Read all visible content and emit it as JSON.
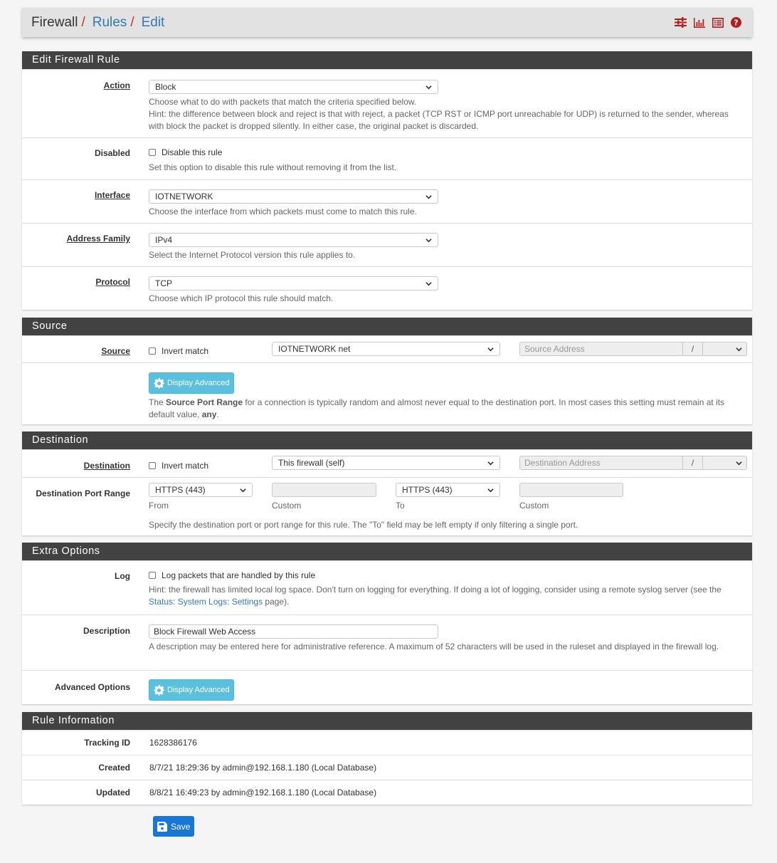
{
  "breadcrumb": {
    "root": "Firewall",
    "items": [
      "Rules",
      "Edit"
    ],
    "separator": "/"
  },
  "header_icons": [
    "sliders-icon",
    "bar-chart-icon",
    "list-icon",
    "help-icon"
  ],
  "colors": {
    "accent_red": "#c9302c",
    "link_blue": "#337ab7",
    "panel_heading_bg": "#424242",
    "info_button": "#5bc0de",
    "primary_button": "#1976d2"
  },
  "edit_rule": {
    "title": "Edit Firewall Rule",
    "action": {
      "label": "Action",
      "value": "Block",
      "help_line1": "Choose what to do with packets that match the criteria specified below.",
      "help_line2": "Hint: the difference between block and reject is that with reject, a packet (TCP RST or ICMP port unreachable for UDP) is returned to the sender, whereas with block the packet is dropped silently. In either case, the original packet is discarded."
    },
    "disabled": {
      "label": "Disabled",
      "checkbox_label": "Disable this rule",
      "checked": false,
      "help": "Set this option to disable this rule without removing it from the list."
    },
    "interface": {
      "label": "Interface",
      "value": "IOTNETWORK",
      "help": "Choose the interface from which packets must come to match this rule."
    },
    "address_family": {
      "label": "Address Family",
      "value": "IPv4",
      "help": "Select the Internet Protocol version this rule applies to."
    },
    "protocol": {
      "label": "Protocol",
      "value": "TCP",
      "help": "Choose which IP protocol this rule should match."
    }
  },
  "source": {
    "title": "Source",
    "label": "Source",
    "invert_label": "Invert match",
    "invert_checked": false,
    "type_value": "IOTNETWORK net",
    "address_placeholder": "Source Address",
    "slash": "/",
    "mask_value": "",
    "advanced_button": "Display Advanced",
    "help_pre": "The ",
    "help_bold": "Source Port Range",
    "help_mid": " for a connection is typically random and almost never equal to the destination port. In most cases this setting must remain at its default value, ",
    "help_bold2": "any",
    "help_post": "."
  },
  "destination": {
    "title": "Destination",
    "label": "Destination",
    "invert_label": "Invert match",
    "invert_checked": false,
    "type_value": "This firewall (self)",
    "address_placeholder": "Destination Address",
    "slash": "/",
    "mask_value": "",
    "port_range_label": "Destination Port Range",
    "from_value": "HTTPS (443)",
    "from_label": "From",
    "from_custom_label": "Custom",
    "to_value": "HTTPS (443)",
    "to_label": "To",
    "to_custom_label": "Custom",
    "help": "Specify the destination port or port range for this rule. The \"To\" field may be left empty if only filtering a single port."
  },
  "extra_options": {
    "title": "Extra Options",
    "log": {
      "label": "Log",
      "checkbox_label": "Log packets that are handled by this rule",
      "checked": false,
      "help_pre": "Hint: the firewall has limited local log space. Don't turn on logging for everything. If doing a lot of logging, consider using a remote syslog server (see the ",
      "help_link": "Status: System Logs: Settings",
      "help_post": " page)."
    },
    "description": {
      "label": "Description",
      "value": "Block Firewall Web Access",
      "help": "A description may be entered here for administrative reference. A maximum of 52 characters will be used in the ruleset and displayed in the firewall log."
    },
    "advanced": {
      "label": "Advanced Options",
      "button": "Display Advanced"
    }
  },
  "rule_info": {
    "title": "Rule Information",
    "rows": [
      {
        "label": "Tracking ID",
        "value": "1628386176"
      },
      {
        "label": "Created",
        "value": "8/7/21 18:29:36 by admin@192.168.1.180 (Local Database)"
      },
      {
        "label": "Updated",
        "value": "8/8/21 16:49:23 by admin@192.168.1.180 (Local Database)"
      }
    ]
  },
  "save_button": "Save"
}
